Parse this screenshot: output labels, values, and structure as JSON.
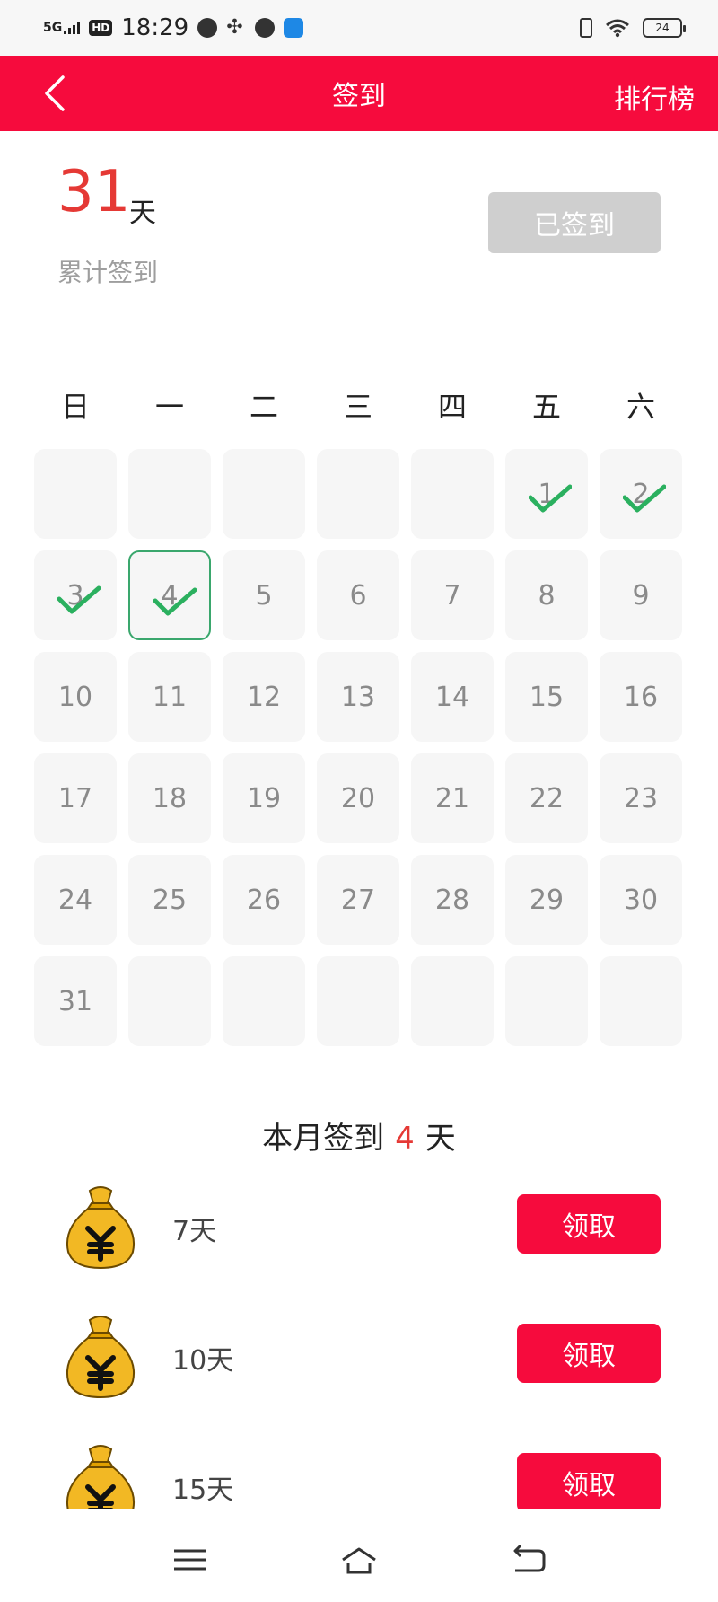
{
  "status_bar": {
    "network": "5G",
    "hd": "HD",
    "time": "18:29",
    "battery": "24"
  },
  "header": {
    "title": "签到",
    "right_link": "排行榜"
  },
  "summary": {
    "total_days": "31",
    "unit": "天",
    "label": "累计签到",
    "signed_button": "已签到"
  },
  "calendar": {
    "weekdays": [
      "日",
      "一",
      "二",
      "三",
      "四",
      "五",
      "六"
    ],
    "cells": [
      "",
      "",
      "",
      "",
      "",
      "1",
      "2",
      "3",
      "4",
      "5",
      "6",
      "7",
      "8",
      "9",
      "10",
      "11",
      "12",
      "13",
      "14",
      "15",
      "16",
      "17",
      "18",
      "19",
      "20",
      "21",
      "22",
      "23",
      "24",
      "25",
      "26",
      "27",
      "28",
      "29",
      "30",
      "31",
      "",
      "",
      "",
      "",
      "",
      ""
    ],
    "signed_days": [
      "1",
      "2",
      "3",
      "4"
    ],
    "today": "4"
  },
  "month_summary": {
    "prefix": "本月签到",
    "count": "4",
    "suffix": "天"
  },
  "rewards": [
    {
      "label": "7天",
      "button": "领取"
    },
    {
      "label": "10天",
      "button": "领取"
    },
    {
      "label": "15天",
      "button": "领取"
    }
  ],
  "colors": {
    "brand_red": "#f60b3d",
    "number_red": "#e53935",
    "check_green": "#2bb05f"
  },
  "icons": {
    "back": "chevron-left-icon",
    "check": "check-icon",
    "reward": "moneybag-icon",
    "nav": [
      "menu-icon",
      "home-icon",
      "back-arrow-icon"
    ]
  }
}
